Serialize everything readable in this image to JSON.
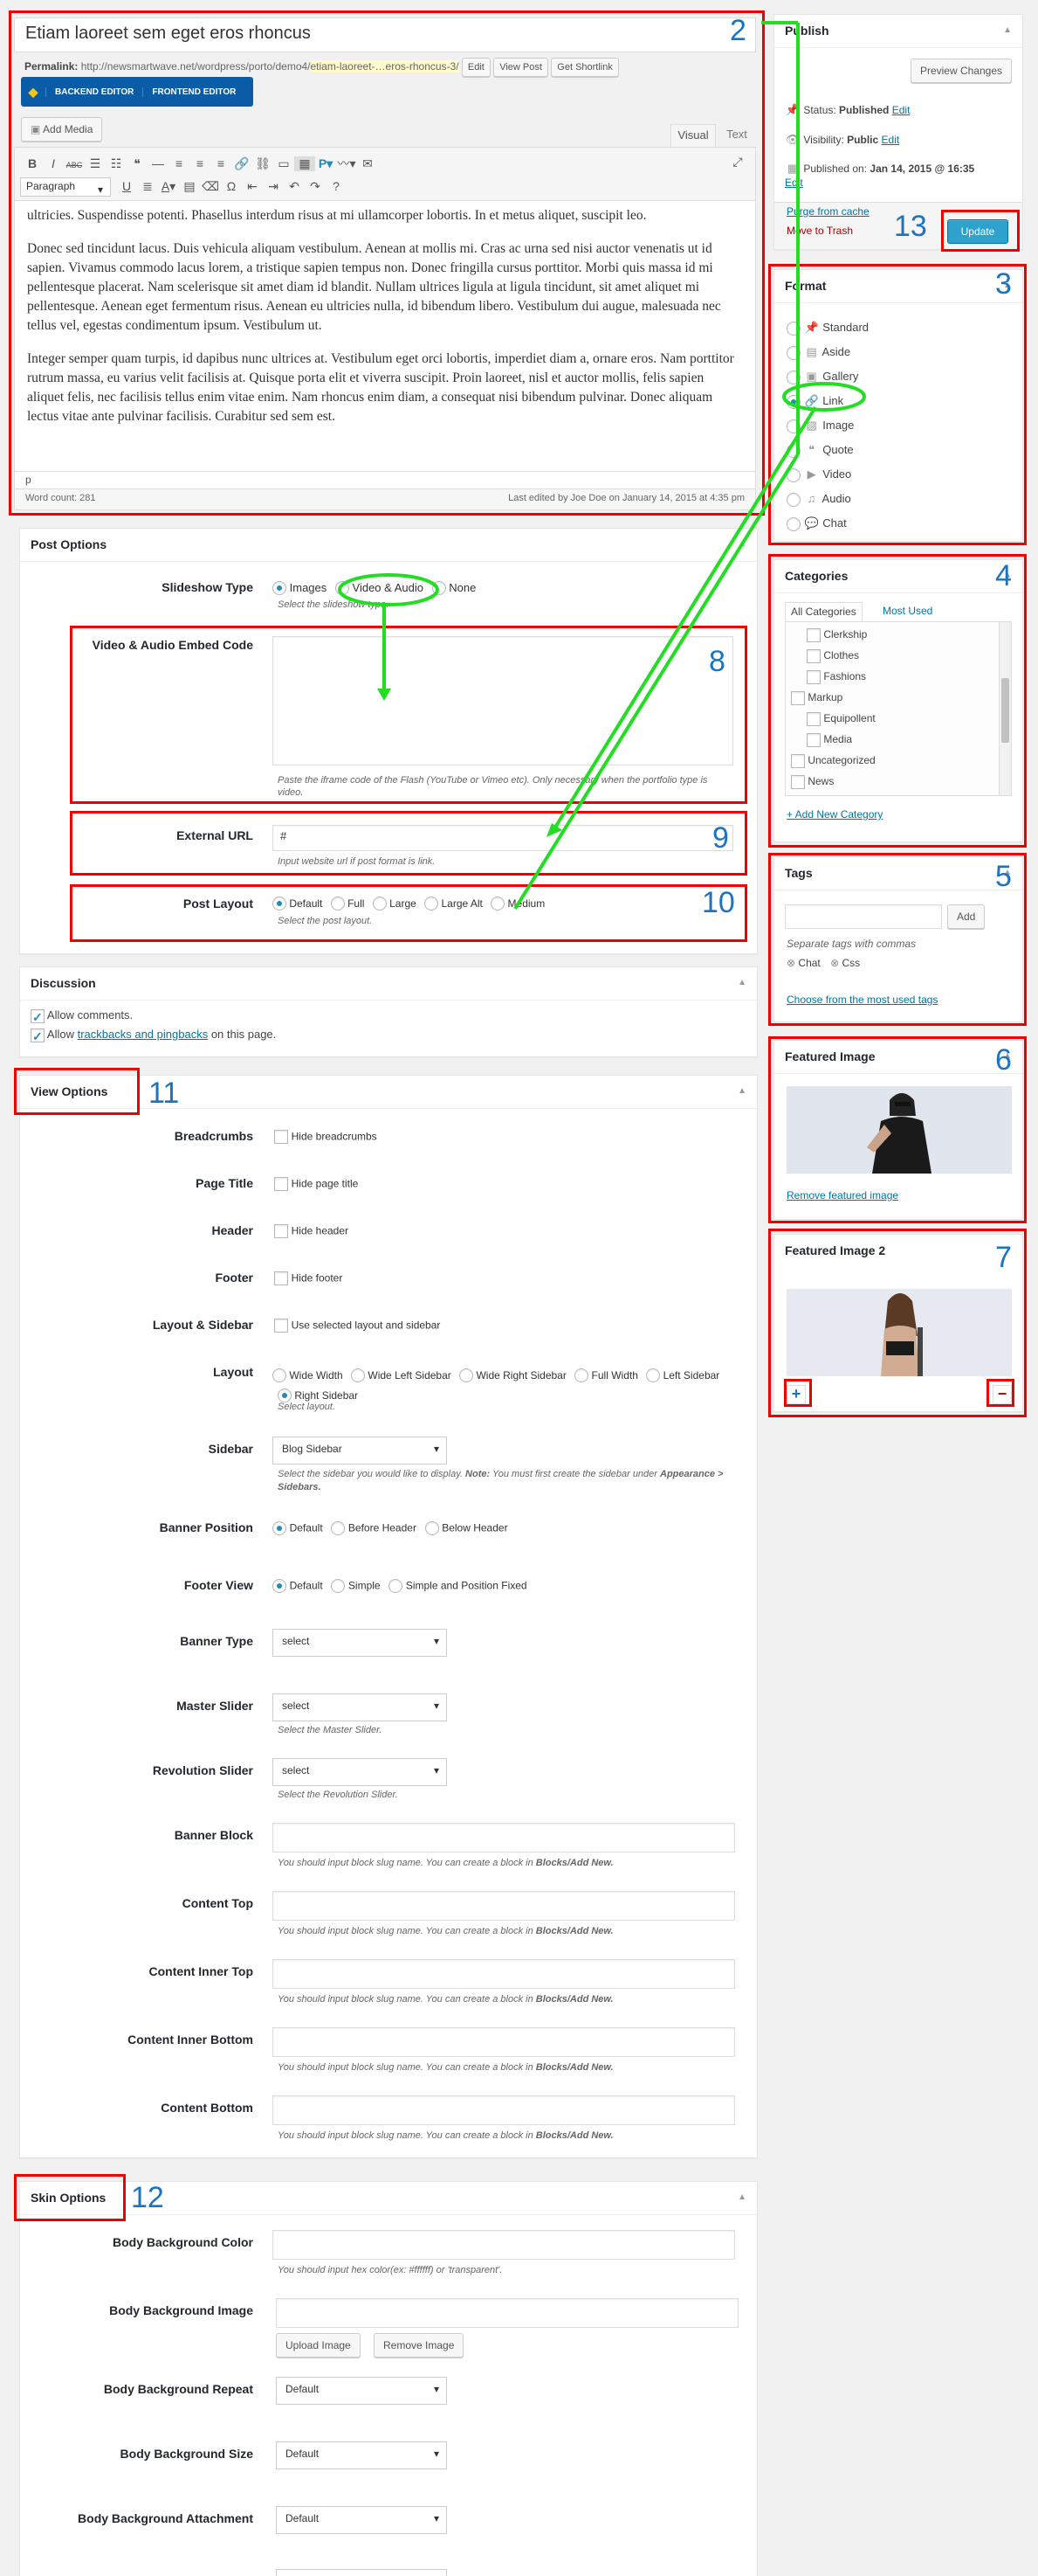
{
  "post": {
    "title": "Etiam laoreet sem eget eros rhoncus",
    "permalink_label": "Permalink:",
    "permalink_base": "http://newsmartwave.net/wordpress/porto/demo4/",
    "permalink_slug": "etiam-laoreet-…eros-rhoncus-3/",
    "edit_btn": "Edit",
    "view_btn": "View Post",
    "shortlink_btn": "Get Shortlink",
    "backend_editor": "BACKEND EDITOR",
    "frontend_editor": "FRONTEND EDITOR",
    "add_media": "Add Media",
    "tab_visual": "Visual",
    "tab_text": "Text",
    "paragraph_select": "Paragraph",
    "content": [
      "ultricies. Suspendisse potenti. Phasellus interdum risus at mi ullamcorper lobortis. In et metus aliquet, suscipit leo.",
      "Donec sed tincidunt lacus. Duis vehicula aliquam vestibulum. Aenean at mollis mi. Cras ac urna sed nisi auctor venenatis ut id sapien. Vivamus commodo lacus lorem, a tristique sapien tempus non. Donec fringilla cursus porttitor. Morbi quis massa id mi pellentesque placerat. Nam scelerisque sit amet diam id blandit. Nullam ultrices ligula at ligula tincidunt, sit amet aliquet mi pellentesque. Aenean eget fermentum risus. Aenean eu ultricies nulla, id bibendum libero. Vestibulum dui augue, malesuada nec tellus vel, egestas condimentum ipsum. Vestibulum ut.",
      "Integer semper quam turpis, id dapibus nunc ultrices at. Vestibulum eget orci lobortis, imperdiet diam a, ornare eros. Nam porttitor rutrum massa, eu varius velit facilisis at. Quisque porta elit et viverra suscipit. Proin laoreet, nisl et auctor mollis, felis sapien aliquet felis, nec facilisis tellus enim vitae enim. Nam rhoncus enim diam, a consequat nisi bibendum pulvinar. Donec aliquam lectus vitae ante pulvinar facilisis. Curabitur sed sem est."
    ],
    "path": "p",
    "word_count": "Word count: 281",
    "last_edited": "Last edited by Joe Doe on January 14, 2015 at 4:35 pm"
  },
  "post_options": {
    "title": "Post Options",
    "slideshow_label": "Slideshow Type",
    "slideshow_opts": [
      "Images",
      "Video & Audio",
      "None"
    ],
    "slideshow_desc": "Select the slideshow type.",
    "embed_label": "Video & Audio Embed Code",
    "embed_desc": "Paste the iframe code of the Flash (YouTube or Vimeo etc). Only necessary when the portfolio type is video.",
    "url_label": "External URL",
    "url_value": "#",
    "url_desc": "Input website url if post format is link.",
    "layout_label": "Post Layout",
    "layout_opts": [
      "Default",
      "Full",
      "Large",
      "Large Alt",
      "Medium"
    ],
    "layout_desc": "Select the post layout."
  },
  "discussion": {
    "title": "Discussion",
    "allow_comments": "Allow comments.",
    "allow_prefix": "Allow",
    "allow_link": "trackbacks and pingbacks",
    "allow_suffix": "on this page."
  },
  "view_options": {
    "title": "View Options",
    "rows": [
      {
        "label": "Breadcrumbs",
        "text": "Hide breadcrumbs"
      },
      {
        "label": "Page Title",
        "text": "Hide page title"
      },
      {
        "label": "Header",
        "text": "Hide header"
      },
      {
        "label": "Footer",
        "text": "Hide footer"
      },
      {
        "label": "Layout & Sidebar",
        "text": "Use selected layout and sidebar"
      }
    ],
    "layout_label": "Layout",
    "layout_opts": [
      "Wide Width",
      "Wide Left Sidebar",
      "Wide Right Sidebar",
      "Full Width",
      "Left Sidebar",
      "Right Sidebar"
    ],
    "layout_desc": "Select layout.",
    "sidebar_label": "Sidebar",
    "sidebar_value": "Blog Sidebar",
    "sidebar_desc_1": "Select the sidebar you would like to display.",
    "sidebar_desc_note": "Note:",
    "sidebar_desc_2": "You must first create the sidebar under",
    "sidebar_desc_path": "Appearance > Sidebars.",
    "banner_pos_label": "Banner Position",
    "banner_pos_opts": [
      "Default",
      "Before Header",
      "Below Header"
    ],
    "footer_view_label": "Footer View",
    "footer_view_opts": [
      "Default",
      "Simple",
      "Simple and Position Fixed"
    ],
    "banner_type_label": "Banner Type",
    "banner_type_value": "select",
    "master_label": "Master Slider",
    "master_value": "select",
    "master_desc": "Select the Master Slider.",
    "rev_label": "Revolution Slider",
    "rev_value": "select",
    "rev_desc": "Select the Revolution Slider.",
    "block_desc_1": "You should input block slug name. You can create a block in",
    "block_desc_path": "Blocks/Add New.",
    "blocks": [
      "Banner Block",
      "Content Top",
      "Content Inner Top",
      "Content Inner Bottom",
      "Content Bottom"
    ]
  },
  "skin_options": {
    "title": "Skin Options",
    "bg_color_label": "Body Background Color",
    "bg_color_desc": "You should input hex color(ex: #ffffff) or 'transparent'.",
    "bg_image_label": "Body Background Image",
    "upload_btn": "Upload Image",
    "remove_btn": "Remove Image",
    "bg_repeat_label": "Body Background Repeat",
    "bg_repeat_value": "Default",
    "bg_size_label": "Body Background Size",
    "bg_size_value": "Default",
    "bg_attach_label": "Body Background Attachment",
    "bg_attach_value": "Default"
  },
  "publish": {
    "title": "Publish",
    "preview_btn": "Preview Changes",
    "status_label": "Status:",
    "status_value": "Published",
    "visibility_label": "Visibility:",
    "visibility_value": "Public",
    "published_label": "Published on:",
    "published_value": "Jan 14, 2015 @ 16:35",
    "edit": "Edit",
    "purge": "Purge from cache",
    "trash": "Move to Trash",
    "update_btn": "Update"
  },
  "format": {
    "title": "Format",
    "options": [
      "Standard",
      "Aside",
      "Gallery",
      "Link",
      "Image",
      "Quote",
      "Video",
      "Audio",
      "Chat"
    ],
    "icons": [
      "pin-icon",
      "aside-icon",
      "gallery-icon",
      "link-icon",
      "image-icon",
      "quote-icon",
      "video-icon",
      "audio-icon",
      "chat-icon"
    ]
  },
  "categories": {
    "title": "Categories",
    "tab_all": "All Categories",
    "tab_used": "Most Used",
    "items": [
      {
        "name": "Clerkship",
        "level": 1
      },
      {
        "name": "Clothes",
        "level": 1
      },
      {
        "name": "Fashions",
        "level": 1
      },
      {
        "name": "Markup",
        "level": 0
      },
      {
        "name": "Equipollent",
        "level": 1
      },
      {
        "name": "Media",
        "level": 1
      },
      {
        "name": "Uncategorized",
        "level": 0
      },
      {
        "name": "News",
        "level": 0
      }
    ],
    "add_new": "+ Add New Category"
  },
  "tags": {
    "title": "Tags",
    "add_btn": "Add",
    "hint": "Separate tags with commas",
    "tag1": "Chat",
    "tag2": "Css",
    "choose": "Choose from the most used tags"
  },
  "featured": {
    "title": "Featured Image",
    "remove": "Remove featured image",
    "title2": "Featured Image 2"
  },
  "annotations": {
    "n2": "2",
    "n3": "3",
    "n4": "4",
    "n5": "5",
    "n6": "6",
    "n7": "7",
    "n8": "8",
    "n9": "9",
    "n10": "10",
    "n11": "11",
    "n12": "12",
    "n13": "13"
  },
  "colors": {
    "annotation_red": "#ee0000",
    "annotation_green": "#22dd22",
    "annotation_number": "#1e73be",
    "primary_button": "#2ea2cc",
    "wpbakery": "#0a5ca6"
  }
}
